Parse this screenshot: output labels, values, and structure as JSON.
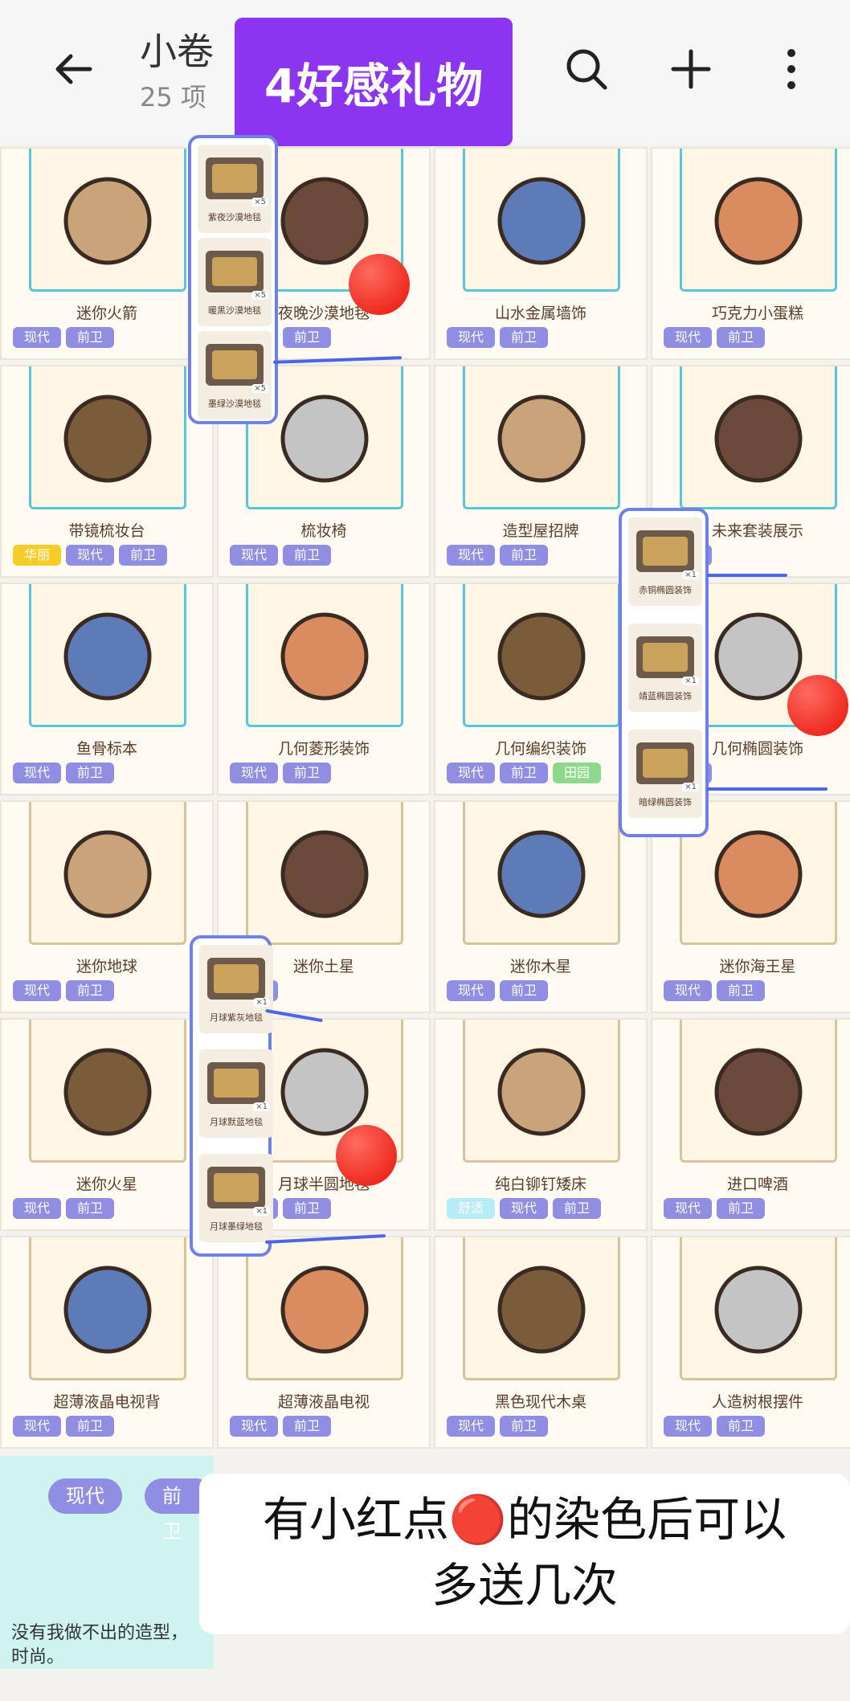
{
  "topbar": {
    "album_title": "小卷",
    "album_count": "25 项",
    "banner_text": "4好感礼物"
  },
  "items": [
    {
      "name": "迷你火箭",
      "tags": [
        "现代",
        "前卫"
      ]
    },
    {
      "name": "夜晚沙漠地毯",
      "tags": [
        "现代",
        "前卫"
      ]
    },
    {
      "name": "山水金属墙饰",
      "tags": [
        "现代",
        "前卫"
      ]
    },
    {
      "name": "巧克力小蛋糕",
      "tags": [
        "现代",
        "前卫"
      ]
    },
    {
      "name": "带镜梳妆台",
      "tags": [
        "华丽",
        "现代",
        "前卫"
      ]
    },
    {
      "name": "梳妆椅",
      "tags": [
        "现代",
        "前卫"
      ]
    },
    {
      "name": "造型屋招牌",
      "tags": [
        "现代",
        "前卫"
      ]
    },
    {
      "name": "未来套装展示",
      "tags": [
        "现代"
      ]
    },
    {
      "name": "鱼骨标本",
      "tags": [
        "现代",
        "前卫"
      ]
    },
    {
      "name": "几何菱形装饰",
      "tags": [
        "现代",
        "前卫"
      ]
    },
    {
      "name": "几何编织装饰",
      "tags": [
        "现代",
        "前卫",
        "田园"
      ]
    },
    {
      "name": "几何椭圆装饰",
      "tags": [
        "前卫"
      ]
    },
    {
      "name": "迷你地球",
      "tags": [
        "现代",
        "前卫"
      ]
    },
    {
      "name": "迷你土星",
      "tags": [
        "前卫"
      ]
    },
    {
      "name": "迷你木星",
      "tags": [
        "现代",
        "前卫"
      ]
    },
    {
      "name": "迷你海王星",
      "tags": [
        "现代",
        "前卫"
      ]
    },
    {
      "name": "迷你火星",
      "tags": [
        "现代",
        "前卫"
      ]
    },
    {
      "name": "月球半圆地毯",
      "tags": [
        "现代",
        "前卫"
      ]
    },
    {
      "name": "纯白铆钉矮床",
      "tags": [
        "舒适",
        "现代",
        "前卫"
      ]
    },
    {
      "name": "进口啤酒",
      "tags": [
        "现代",
        "前卫"
      ]
    },
    {
      "name": "超薄液晶电视背",
      "tags": [
        "现代",
        "前卫"
      ]
    },
    {
      "name": "超薄液晶电视",
      "tags": [
        "现代",
        "前卫"
      ]
    },
    {
      "name": "黑色现代木桌",
      "tags": [
        "现代",
        "前卫"
      ]
    },
    {
      "name": "人造树根摆件",
      "tags": [
        "现代",
        "前卫"
      ]
    }
  ],
  "overlay_carpets": [
    {
      "label": "紫夜沙漠地毯",
      "qty": "×5"
    },
    {
      "label": "暖黑沙漠地毯",
      "qty": "×5"
    },
    {
      "label": "墨绿沙漠地毯",
      "qty": "×5"
    }
  ],
  "overlay_ellipse": [
    {
      "label": "赤铜椭圆装饰",
      "qty": "×1"
    },
    {
      "label": "靖蓝椭圆装饰",
      "qty": "×1"
    },
    {
      "label": "暗绿椭圆装饰",
      "qty": "×1"
    }
  ],
  "overlay_moon": [
    {
      "label": "月球紫灰地毯",
      "qty": "×1"
    },
    {
      "label": "月球默蓝地毯",
      "qty": "×1"
    },
    {
      "label": "月球墨绿地毯",
      "qty": "×1"
    }
  ],
  "bottom": {
    "tag_modern": "现代",
    "tag_avant": "前卫",
    "slogan_line1": "没有我做不出的造型，",
    "slogan_line2": "时尚。",
    "note_line1": "有小红点🔴的染色后可以",
    "note_line2": "多送几次"
  },
  "colors": {
    "banner": "#8c35f0",
    "frame": "#56c6d8",
    "tag": "#8f8ee3",
    "red_dot": "#e81308",
    "overlay_border": "#6f80e8"
  },
  "icons": [
    "back-arrow-icon",
    "search-icon",
    "plus-icon",
    "more-vertical-icon"
  ]
}
